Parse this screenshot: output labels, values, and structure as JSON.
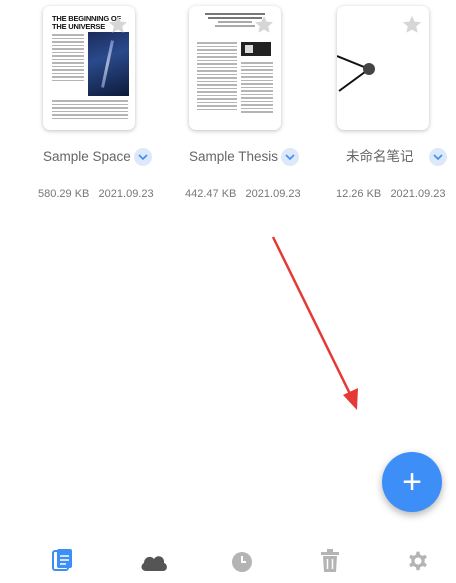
{
  "files": [
    {
      "name": "Sample Space",
      "size": "580.29 KB",
      "date": "2021.09.23",
      "thumb_title": "THE BEGINNING OF THE UNIVERSE"
    },
    {
      "name": "Sample Thesis",
      "size": "442.47 KB",
      "date": "2021.09.23"
    },
    {
      "name": "未命名笔记",
      "size": "12.26 KB",
      "date": "2021.09.23"
    }
  ],
  "fab": {
    "label": "+"
  },
  "colors": {
    "accent": "#3d8ef7",
    "star": "#d6d6d6",
    "chevron_bg": "#dde9fb",
    "nav_active": "#3d8ef7",
    "nav_inactive": "#b4b4b4",
    "annotation_arrow": "#e53935"
  },
  "nav": {
    "items": [
      {
        "icon": "documents-icon",
        "active": true
      },
      {
        "icon": "cloud-icon",
        "active": false
      },
      {
        "icon": "clock-icon",
        "active": false
      },
      {
        "icon": "trash-icon",
        "active": false
      },
      {
        "icon": "gear-icon",
        "active": false
      }
    ]
  }
}
